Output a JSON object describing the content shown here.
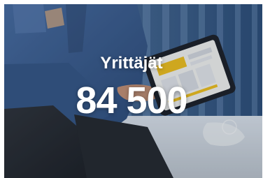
{
  "statistic": {
    "label": "Yrittäjät",
    "value": "84 500"
  },
  "colors": {
    "text": "#ffffff",
    "background_curtain": "#3f5f87",
    "shirt": "#476a9d",
    "tablet_screen": "#f3c31d"
  }
}
